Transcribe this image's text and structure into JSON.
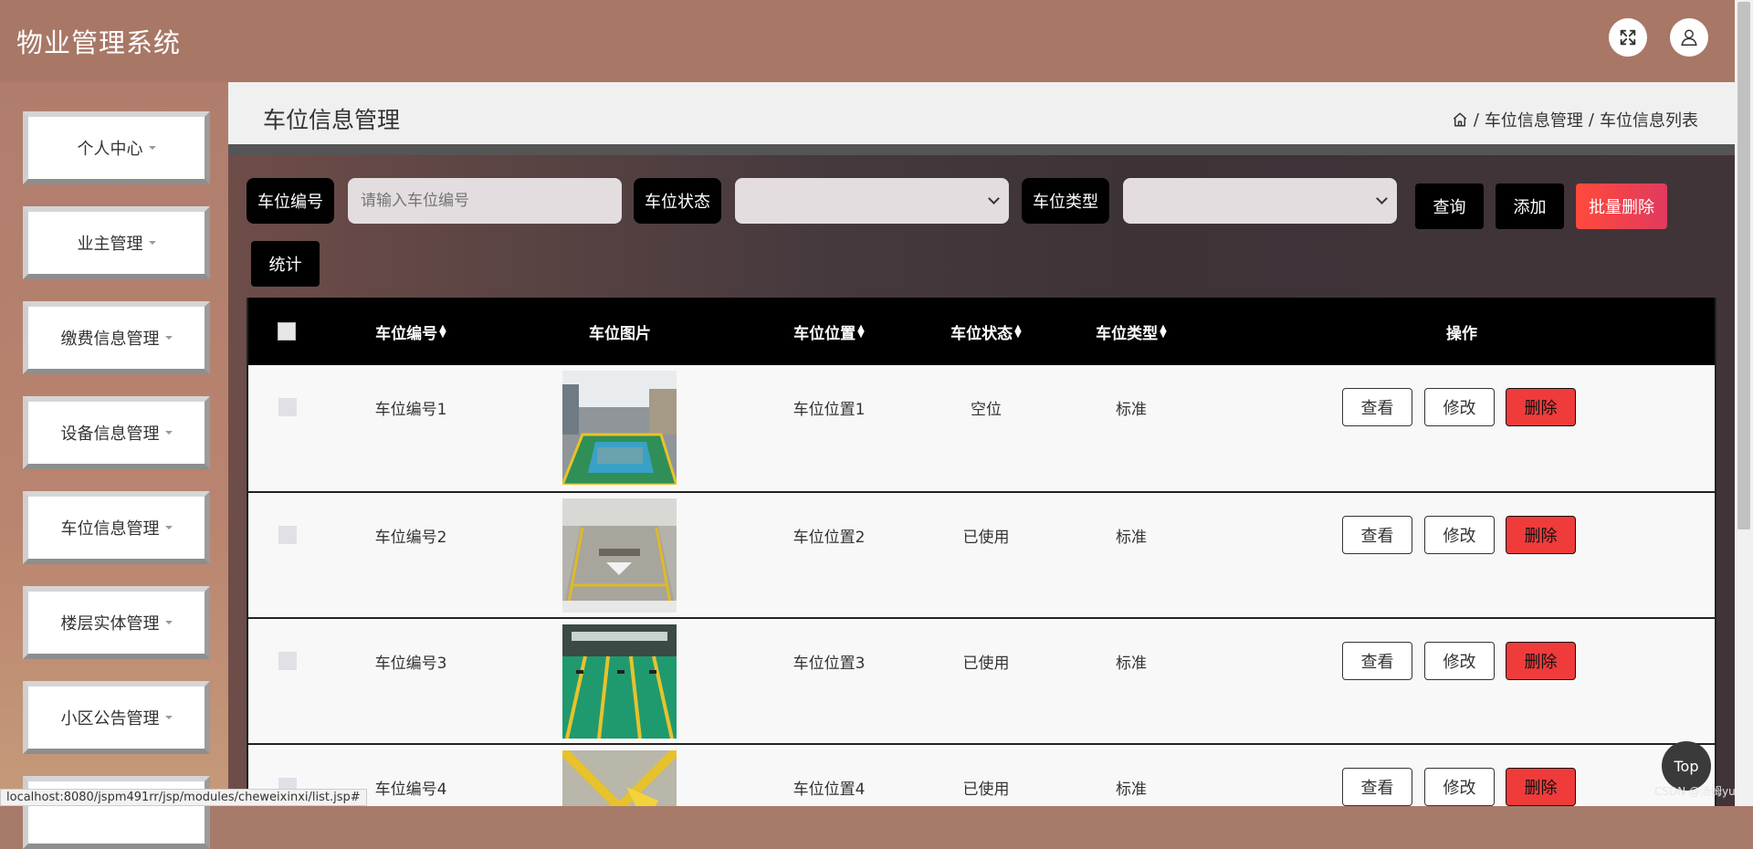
{
  "app": {
    "title": "物业管理系统"
  },
  "colors": {
    "header_bg": "#a87766",
    "sidebar_bg": "#b07d6d",
    "accent_red": "#f03b3b",
    "batch_delete_gradient": [
      "#ff4a3c",
      "#e03a5f"
    ],
    "table_header_bg": "#000000"
  },
  "header": {
    "fullscreen_icon": "expand-arrows-icon",
    "user_icon": "user-icon"
  },
  "sidebar": {
    "items": [
      {
        "label": "个人中心"
      },
      {
        "label": "业主管理"
      },
      {
        "label": "缴费信息管理"
      },
      {
        "label": "设备信息管理"
      },
      {
        "label": "车位信息管理"
      },
      {
        "label": "楼层实体管理"
      },
      {
        "label": "小区公告管理"
      }
    ]
  },
  "page": {
    "title": "车位信息管理",
    "breadcrumb": [
      "车位信息管理",
      "车位信息列表"
    ],
    "breadcrumb_sep": "/"
  },
  "search": {
    "code_label": "车位编号",
    "code_placeholder": "请输入车位编号",
    "status_label": "车位状态",
    "status_value": "",
    "type_label": "车位类型",
    "type_value": ""
  },
  "toolbar": {
    "query": "查询",
    "add": "添加",
    "batch_delete": "批量删除",
    "stats": "统计"
  },
  "table": {
    "headers": {
      "code": "车位编号",
      "image": "车位图片",
      "location": "车位位置",
      "status": "车位状态",
      "type": "车位类型",
      "actions": "操作"
    },
    "sort_up": "▲",
    "sort_down": "▼",
    "actions": {
      "view": "查看",
      "edit": "修改",
      "delete": "删除"
    },
    "rows": [
      {
        "code": "车位编号1",
        "location": "车位位置1",
        "status": "空位",
        "type": "标准"
      },
      {
        "code": "车位编号2",
        "location": "车位位置2",
        "status": "已使用",
        "type": "标准"
      },
      {
        "code": "车位编号3",
        "location": "车位位置3",
        "status": "已使用",
        "type": "标准"
      },
      {
        "code": "车位编号4",
        "location": "车位位置4",
        "status": "已使用",
        "type": "标准"
      }
    ]
  },
  "statusbar": {
    "url": "localhost:8080/jspm491rr/jsp/modules/cheweixinxi/list.jsp#"
  },
  "top_button": {
    "label": "Top"
  },
  "watermark": {
    "text": "CSDN @汤姆yu"
  }
}
